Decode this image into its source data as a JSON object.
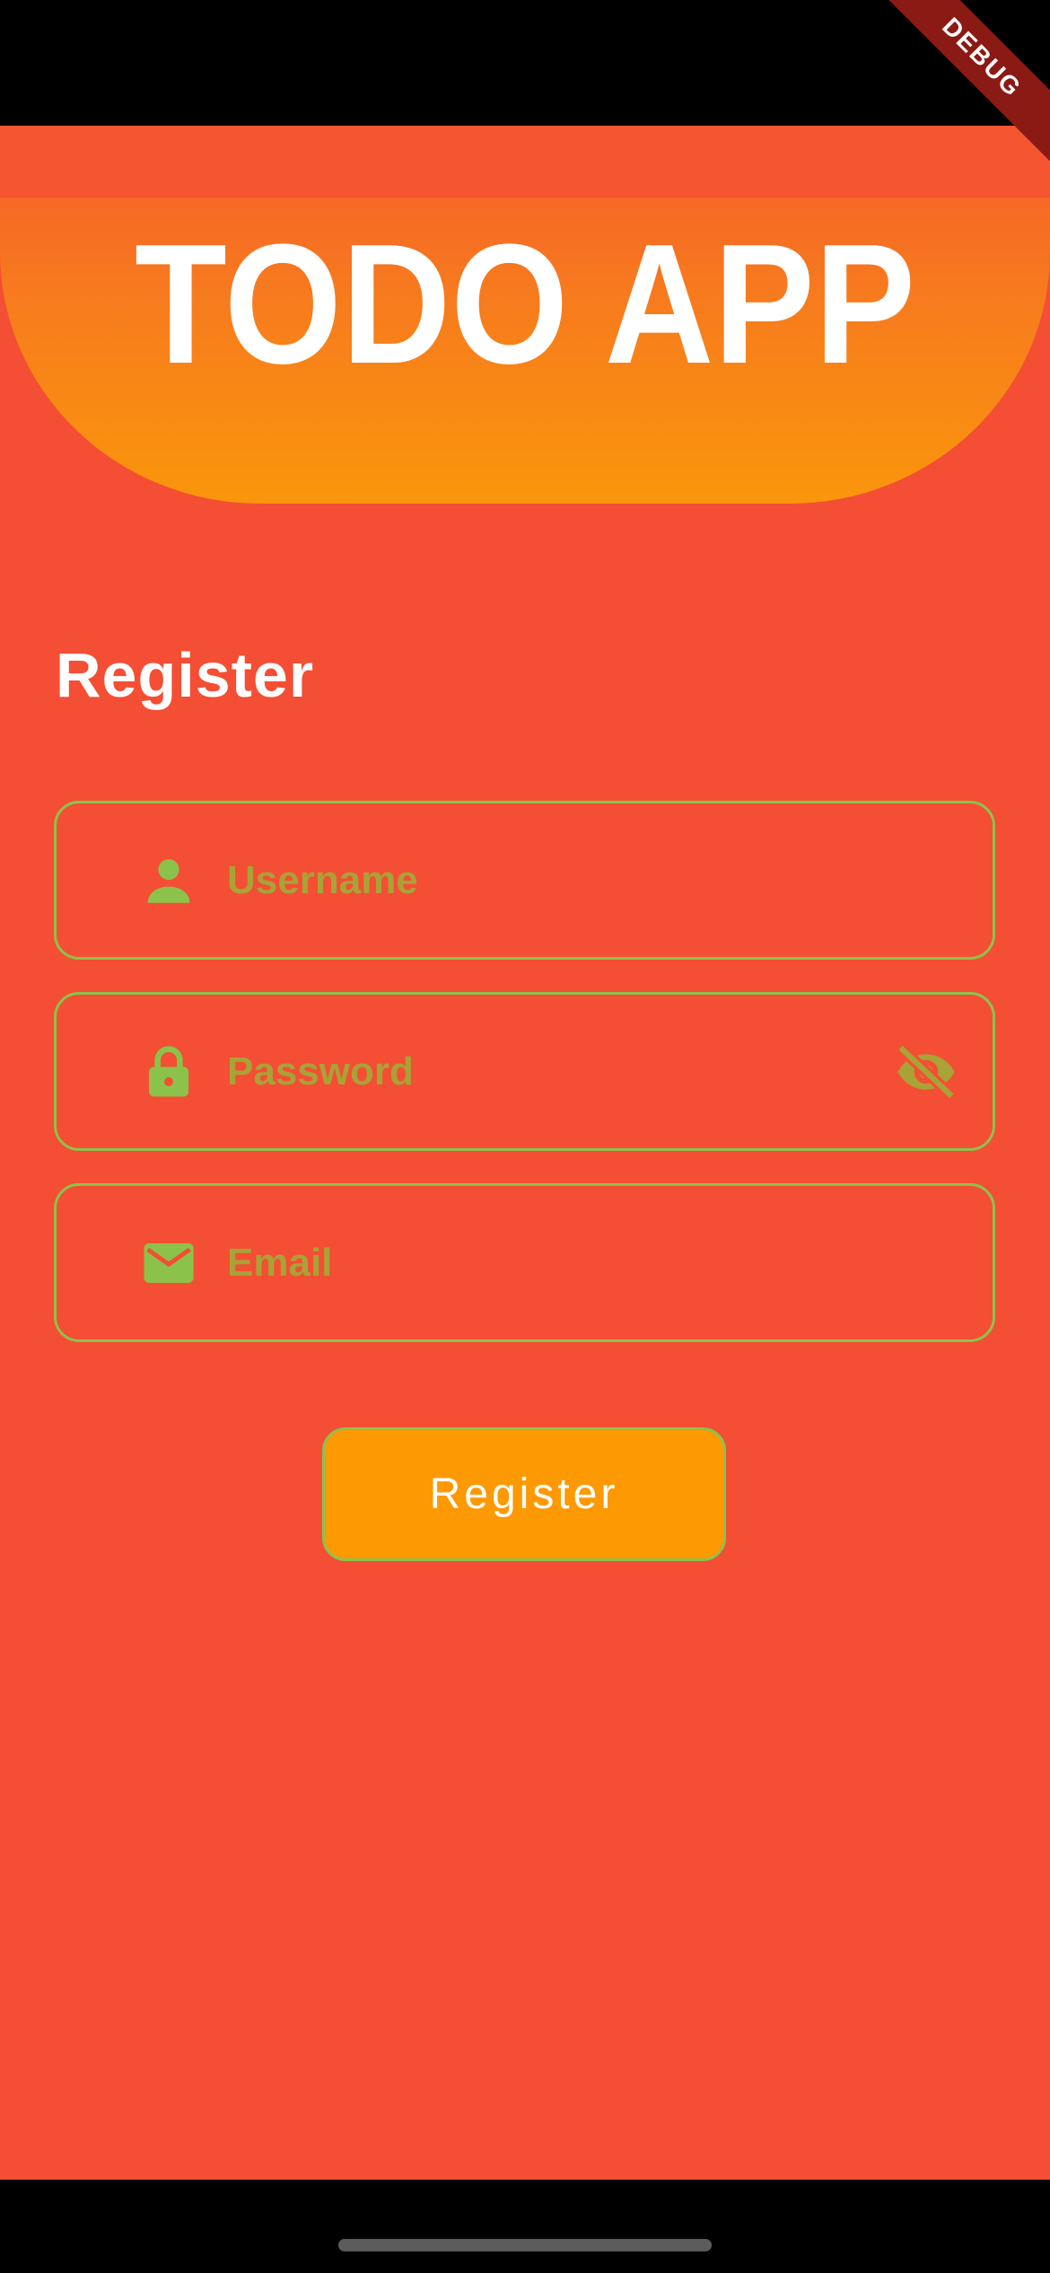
{
  "app": {
    "logo_text": "TODO APP",
    "debug_label": "DEBUG"
  },
  "page": {
    "heading": "Register"
  },
  "form": {
    "username": {
      "placeholder": "Username",
      "icon": "person-icon"
    },
    "password": {
      "placeholder": "Password",
      "icon": "lock-icon",
      "toggle_icon": "visibility-off-icon"
    },
    "email": {
      "placeholder": "Email",
      "icon": "mail-icon"
    }
  },
  "actions": {
    "register_label": "Register"
  },
  "colors": {
    "background": "#F44E34",
    "header_gradient_top": "#F55B2C",
    "header_gradient_bottom": "#FA960B",
    "field_border": "#8BC34A",
    "icon_green": "#8BC34A",
    "placeholder": "#A9A237",
    "button": "#FD9902",
    "debug_ribbon": "#8B1A14"
  }
}
